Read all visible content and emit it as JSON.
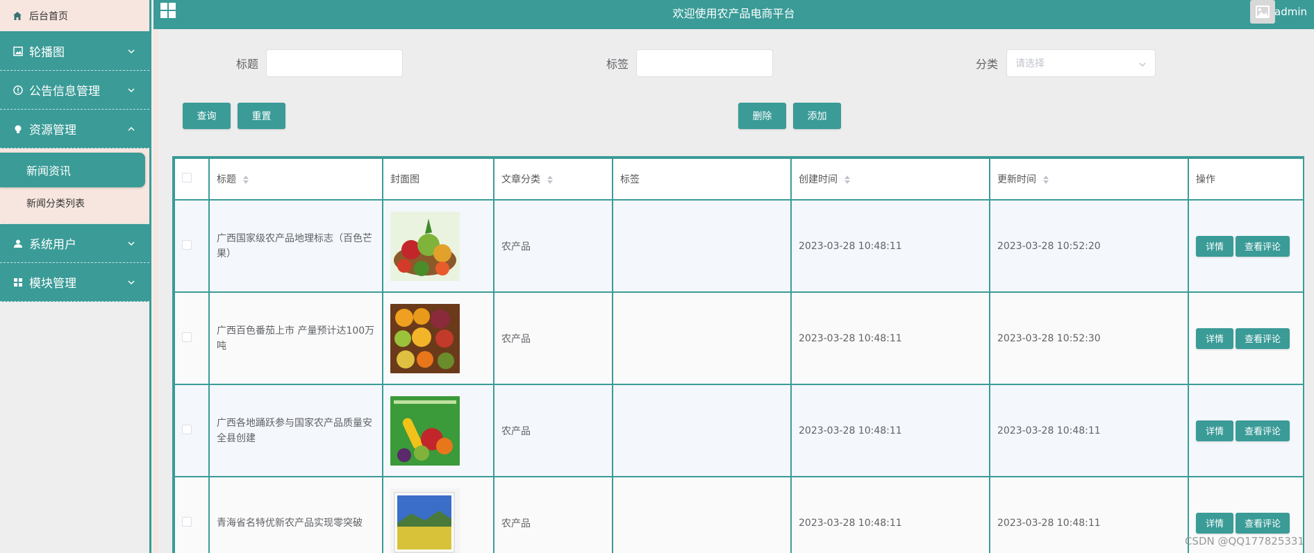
{
  "sidebar": {
    "home_label": "后台首页",
    "menus": [
      {
        "label": "轮播图",
        "icon": "image-icon",
        "expanded": false
      },
      {
        "label": "公告信息管理",
        "icon": "info-circle-icon",
        "expanded": false
      },
      {
        "label": "资源管理",
        "icon": "bulb-icon",
        "expanded": true
      },
      {
        "label": "系统用户",
        "icon": "user-icon",
        "expanded": false
      },
      {
        "label": "模块管理",
        "icon": "grid-icon",
        "expanded": false
      }
    ],
    "submenu": {
      "active_label": "新闻资讯",
      "item_label": "新闻分类列表"
    }
  },
  "header": {
    "title": "欢迎使用农产品电商平台",
    "username": "admin"
  },
  "search": {
    "title_label": "标题",
    "title_value": "",
    "tag_label": "标签",
    "tag_value": "",
    "category_label": "分类",
    "category_placeholder": "请选择"
  },
  "buttons": {
    "query": "查询",
    "reset": "重置",
    "delete": "删除",
    "add": "添加"
  },
  "table": {
    "headers": {
      "title": "标题",
      "cover": "封面图",
      "category": "文章分类",
      "tags": "标签",
      "created": "创建时间",
      "updated": "更新时间",
      "actions": "操作"
    },
    "detail_label": "详情",
    "comments_label": "查看评论",
    "rows": [
      {
        "title": "广西国家级农产品地理标志（百色芒果）",
        "category": "农产品",
        "tags": "",
        "created": "2023-03-28 10:48:11",
        "updated": "2023-03-28 10:52:20"
      },
      {
        "title": "广西百色番茄上市 产量预计达100万吨",
        "category": "农产品",
        "tags": "",
        "created": "2023-03-28 10:48:11",
        "updated": "2023-03-28 10:52:30"
      },
      {
        "title": "广西各地踊跃参与国家农产品质量安全县创建",
        "category": "农产品",
        "tags": "",
        "created": "2023-03-28 10:48:11",
        "updated": "2023-03-28 10:48:11"
      },
      {
        "title": "青海省名特优新农产品实现零突破",
        "category": "农产品",
        "tags": "",
        "created": "2023-03-28 10:48:11",
        "updated": "2023-03-28 10:48:11"
      }
    ]
  },
  "colors": {
    "accent": "#3a9b97",
    "sidebar_light": "#f7e6df",
    "background": "#eeeeee"
  },
  "watermark": "CSDN @QQ177825331"
}
